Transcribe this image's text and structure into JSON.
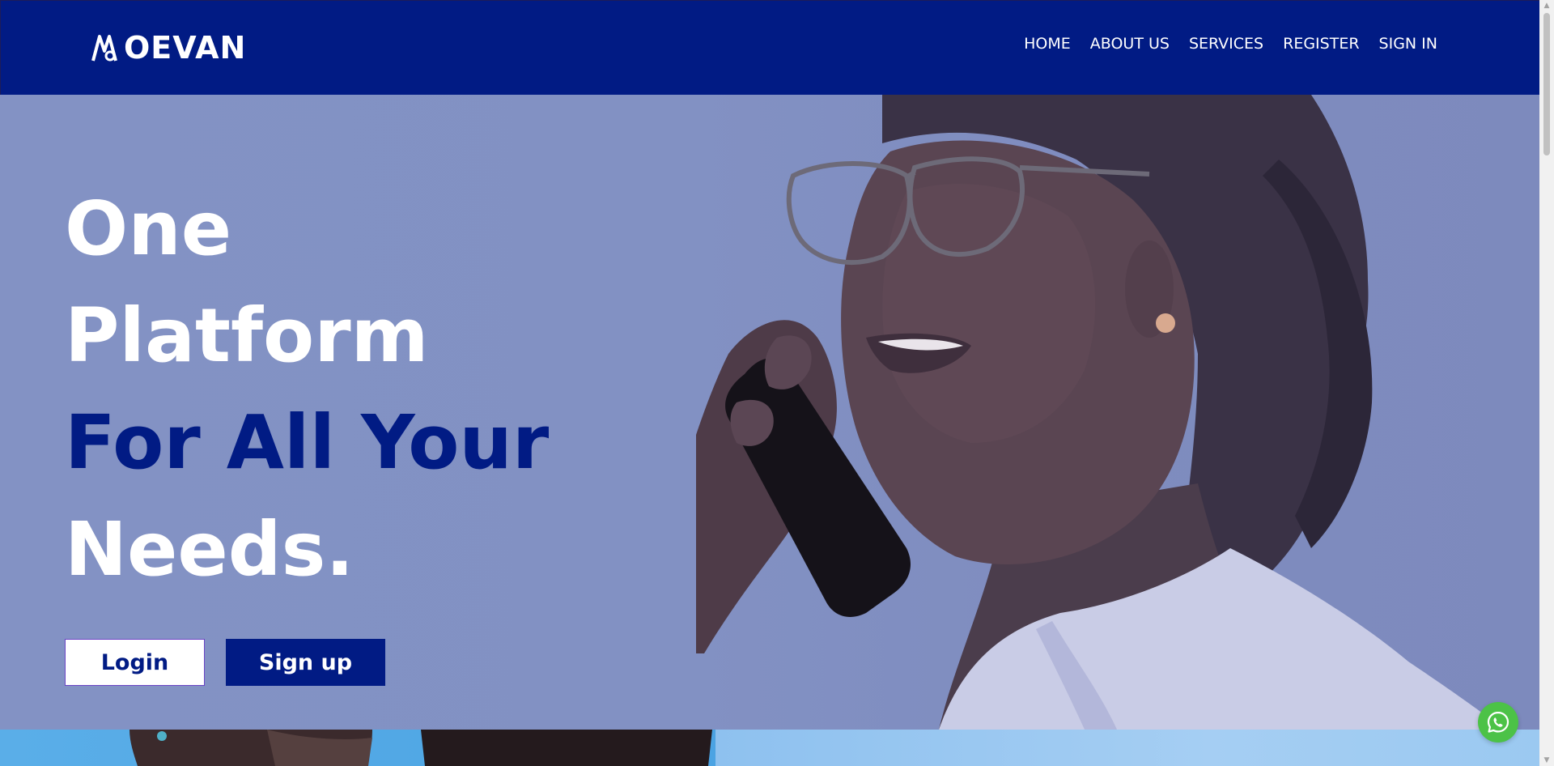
{
  "header": {
    "logo_text": "OEVAN",
    "nav": [
      "HOME",
      "ABOUT US",
      "SERVICES",
      "REGISTER",
      "SIGN IN"
    ]
  },
  "hero": {
    "headline": {
      "line1": "One",
      "line2": "Platform",
      "line3": "For All Your",
      "line4": "Needs."
    },
    "login_label": "Login",
    "signup_label": "Sign up"
  },
  "widgets": {
    "whatsapp_icon": "whatsapp-icon"
  },
  "colors": {
    "brand_navy": "#011b84",
    "hero_overlay": "#8392c4",
    "whatsapp_green": "#4cc247",
    "white": "#ffffff"
  }
}
